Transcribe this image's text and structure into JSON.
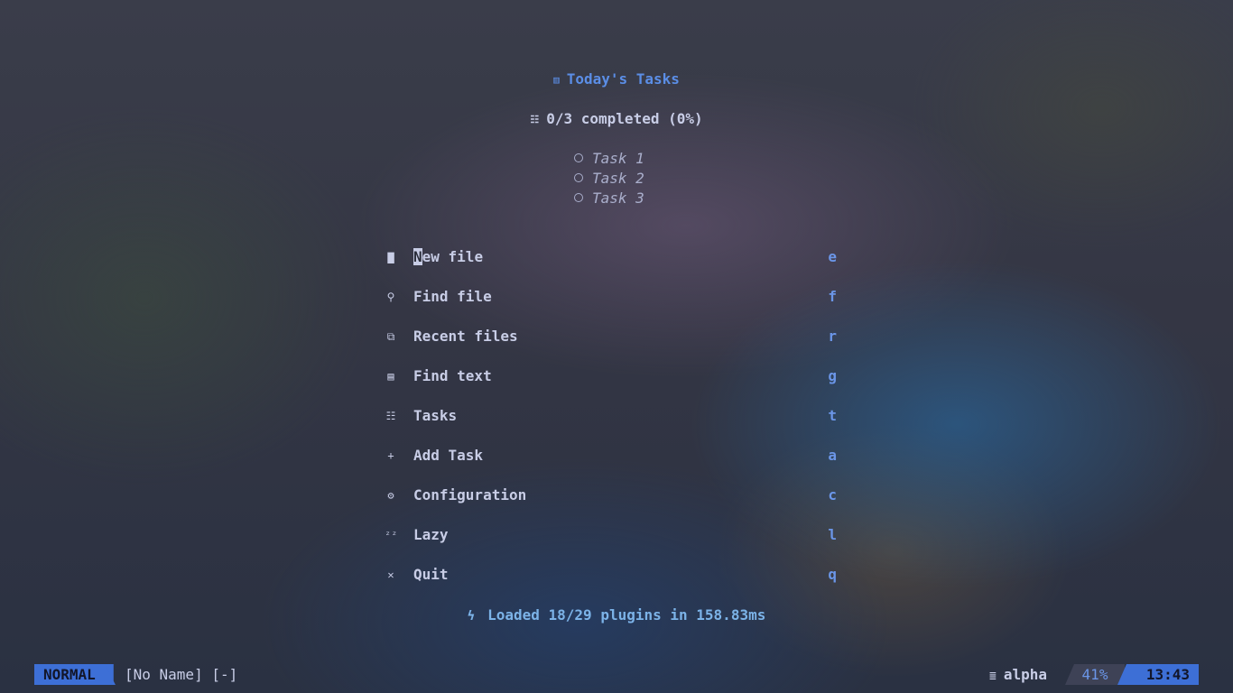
{
  "dashboard": {
    "header": {
      "icon": "calendar-icon",
      "glyph": "▥",
      "title": "Today's Tasks"
    },
    "summary": {
      "icon": "checklist-icon",
      "glyph": "☷",
      "text": "0/3 completed (0%)"
    },
    "tasks": [
      {
        "label": "Task 1",
        "done": false
      },
      {
        "label": "Task 2",
        "done": false
      },
      {
        "label": "Task 3",
        "done": false
      }
    ],
    "menu": [
      {
        "icon": "file-icon",
        "glyph": "▇",
        "label_first": "N",
        "label_rest": "ew file",
        "key": "e"
      },
      {
        "icon": "search-icon",
        "glyph": "⚲",
        "label": "Find file",
        "key": "f"
      },
      {
        "icon": "recent-files-icon",
        "glyph": "⧉",
        "label": "Recent files",
        "key": "r"
      },
      {
        "icon": "text-search-icon",
        "glyph": "▤",
        "label": "Find text",
        "key": "g"
      },
      {
        "icon": "tasks-icon",
        "glyph": "☷",
        "label": "Tasks",
        "key": "t"
      },
      {
        "icon": "plus-icon",
        "glyph": "+",
        "label": "Add Task",
        "key": "a"
      },
      {
        "icon": "gear-icon",
        "glyph": "⚙",
        "label": "Configuration",
        "key": "c"
      },
      {
        "icon": "sleep-icon",
        "glyph": "ᶻᶻ",
        "label": "Lazy",
        "key": "l"
      },
      {
        "icon": "close-icon",
        "glyph": "✕",
        "label": "Quit",
        "key": "q"
      }
    ],
    "footer": {
      "icon": "lightning-icon",
      "glyph": "ϟ",
      "text": "Loaded 18/29 plugins in 158.83ms"
    }
  },
  "statusline": {
    "mode": "NORMAL",
    "filename": "[No Name] [-]",
    "filetype_icon": "file-lines-icon",
    "filetype_glyph": "≣",
    "filetype": "alpha",
    "progress": "41%",
    "clock": "13:43"
  },
  "colors": {
    "accent": "#3d6fd6",
    "title": "#5b8ee6",
    "key": "#6b96e8",
    "text": "#c8cde6",
    "footer": "#7cb3e8"
  }
}
